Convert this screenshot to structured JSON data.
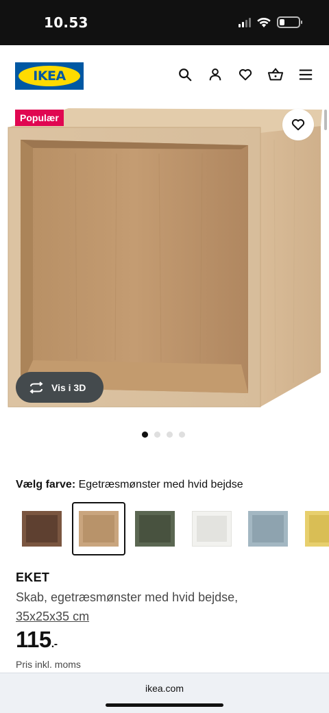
{
  "status_bar": {
    "time": "10.53"
  },
  "header": {
    "logo_text": "IKEA",
    "icons": [
      "search-icon",
      "user-icon",
      "heart-icon",
      "basket-icon",
      "menu-icon"
    ]
  },
  "hero": {
    "badge": "Populær",
    "view_3d_label": "Vis i 3D",
    "carousel_total": 4,
    "carousel_active": 1
  },
  "color_picker": {
    "label": "Vælg farve:",
    "selected_name": "Egetræsmønster med hvid bejdse",
    "swatches": [
      {
        "color": "#7a5640",
        "inner": "#5e4030",
        "selected": false
      },
      {
        "color": "#c9a57e",
        "inner": "#b8936a",
        "selected": true
      },
      {
        "color": "#5b6752",
        "inner": "#48523f",
        "selected": false
      },
      {
        "color": "#f2f2ef",
        "inner": "#e3e3df",
        "selected": false
      },
      {
        "color": "#a3b7c2",
        "inner": "#8ea3af",
        "selected": false
      },
      {
        "color": "#e7cf6d",
        "inner": "#d9be55",
        "selected": false
      }
    ]
  },
  "product": {
    "name": "EKET",
    "description": "Skab, egetræsmønster med hvid bejdse,",
    "dimensions": "35x25x35 cm",
    "price": "115",
    "price_suffix": ".-",
    "vat_note": "Pris inkl. moms"
  },
  "browser": {
    "url": "ikea.com"
  },
  "colors": {
    "brand_blue": "#0058a3",
    "brand_yellow": "#ffdb00",
    "badge_red": "#e00751"
  }
}
